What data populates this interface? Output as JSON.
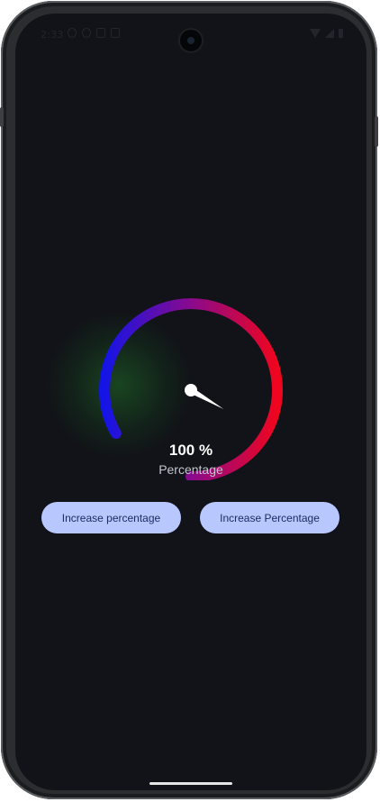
{
  "status_bar": {
    "time": "2:33"
  },
  "gauge": {
    "value_percent": 100,
    "value_text": "100 %",
    "label": "Percentage",
    "gradient_colors": [
      "#1414e6",
      "#8a0a8c",
      "#f0051e"
    ],
    "needle_color": "#ffffff"
  },
  "buttons": {
    "left_label": "Increase percentage",
    "right_label": "Increase Percentage",
    "color": "#b8c8ff"
  },
  "theme": {
    "background": "#111318"
  }
}
